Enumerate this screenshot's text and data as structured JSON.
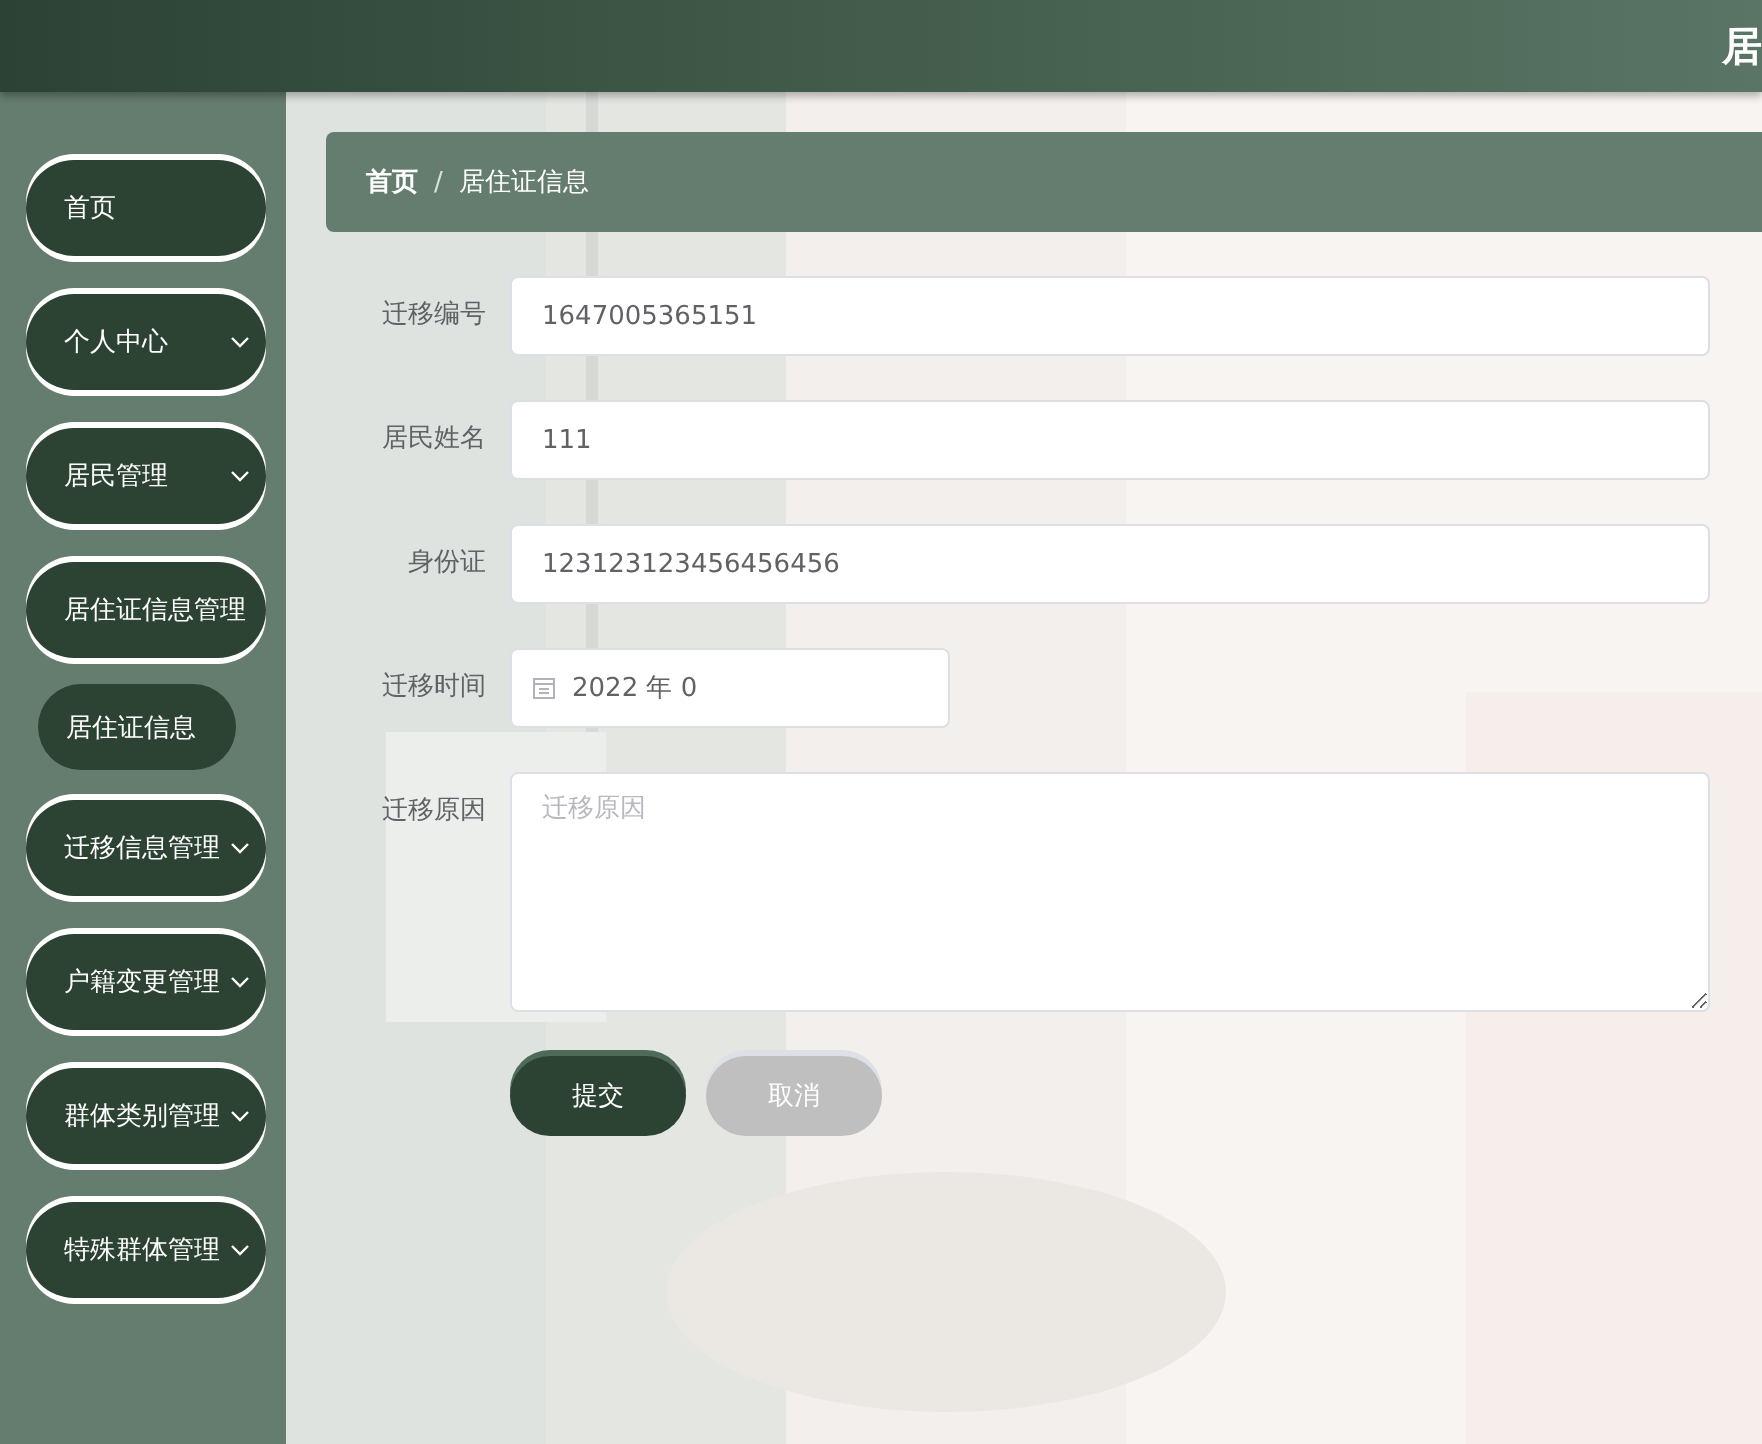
{
  "header": {
    "title": "居"
  },
  "sidebar": {
    "items": [
      {
        "label": "首页"
      },
      {
        "label": "个人中心",
        "expanded": false
      },
      {
        "label": "居民管理",
        "expanded": false
      },
      {
        "label": "居住证信息管理",
        "expanded": true,
        "children": [
          {
            "label": "居住证信息"
          }
        ]
      },
      {
        "label": "迁移信息管理",
        "expanded": false
      },
      {
        "label": "户籍变更管理",
        "expanded": false
      },
      {
        "label": "群体类别管理",
        "expanded": false
      },
      {
        "label": "特殊群体管理",
        "expanded": false
      }
    ]
  },
  "breadcrumb": [
    "首页",
    "居住证信息"
  ],
  "breadcrumb_separator": "/",
  "form": {
    "fields": [
      {
        "kind": "text",
        "label": "迁移编号",
        "value": "1647005365151"
      },
      {
        "kind": "text",
        "label": "居民姓名",
        "value": "111"
      },
      {
        "kind": "text",
        "label": "身份证",
        "value": "123123123456456456"
      },
      {
        "kind": "date",
        "label": "迁移时间",
        "value": "2022 年 0"
      },
      {
        "kind": "textarea",
        "label": "迁移原因",
        "placeholder": "迁移原因"
      }
    ],
    "buttons": [
      {
        "kind": "primary",
        "label": "提交"
      },
      {
        "kind": "secondary",
        "label": "取消"
      }
    ]
  }
}
